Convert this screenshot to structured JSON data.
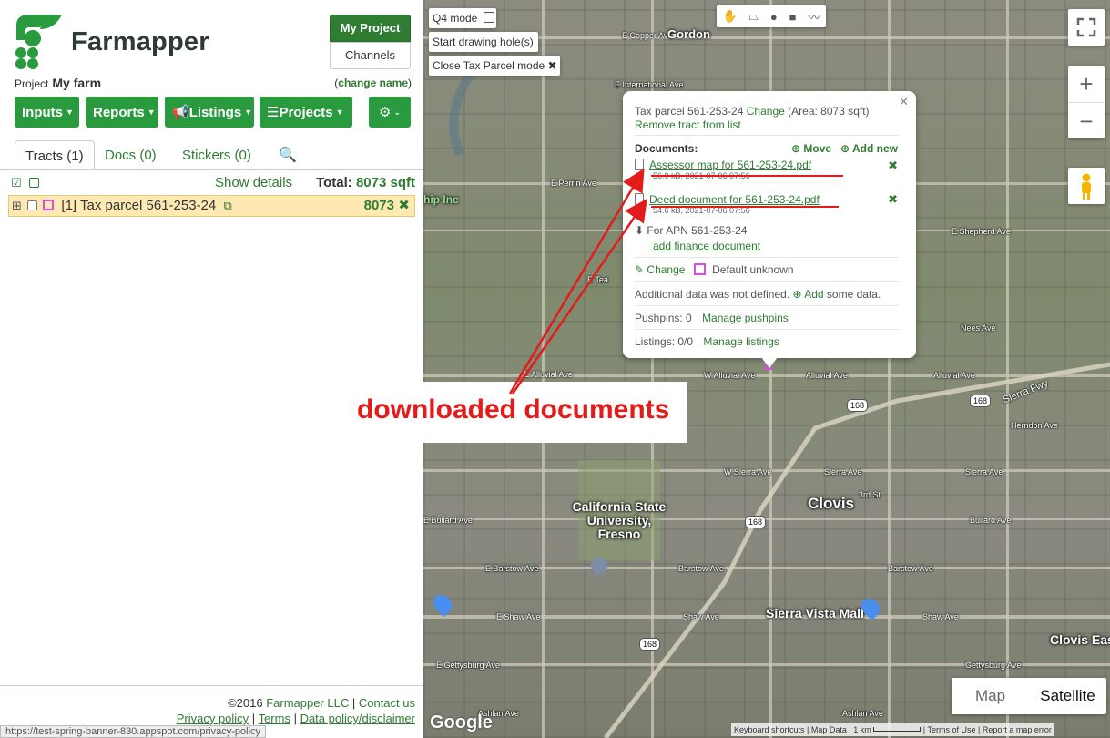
{
  "brand": {
    "name": "Farmapper"
  },
  "header": {
    "my_project_label": "My Project",
    "channels_label": "Channels"
  },
  "project": {
    "prefix": "Project",
    "name": "My farm",
    "change_label": "change name"
  },
  "menu": {
    "inputs": "Inputs",
    "reports": "Reports",
    "listings": "Listings",
    "projects": "Projects"
  },
  "tabs": [
    {
      "label": "Tracts (1)",
      "active": true
    },
    {
      "label": "Docs (0)",
      "active": false
    },
    {
      "label": "Stickers (0)",
      "active": false
    }
  ],
  "tracts": {
    "show_details_label": "Show details",
    "total_label": "Total:",
    "total_value": "8073 sqft",
    "rows": [
      {
        "label": "[1] Tax parcel 561-253-24",
        "area": "8073"
      }
    ]
  },
  "footer": {
    "copyright": "©2016",
    "company": "Farmapper LLC",
    "contact": "Contact us",
    "privacy": "Privacy policy",
    "terms": "Terms",
    "data_policy": "Data policy/disclaimer"
  },
  "status_url": "https://test-spring-banner-830.appspot.com/privacy-policy",
  "map": {
    "q4_mode_label": "Q4 mode",
    "start_drawing_label": "Start drawing hole(s)",
    "close_tax_label": "Close Tax Parcel mode",
    "map_type_map": "Map",
    "map_type_satellite": "Satellite",
    "google_logo": "Google",
    "attribution": {
      "shortcuts": "Keyboard shortcuts",
      "map_data": "Map Data",
      "scale": "1 km",
      "terms": "Terms of Use",
      "report": "Report a map error"
    },
    "places": {
      "gordon": "Gordon",
      "clovis": "Clovis",
      "csu": "California State University, Fresno",
      "sierra_vista": "Sierra Vista Mall",
      "clovis_east": "Clovis Eas",
      "ship_inc": "hip Inc"
    },
    "roads": {
      "copper": "E Copper Ave",
      "international": "E International Ave",
      "perrin": "E Perrin Ave",
      "shepherd": "E Shepherd Ave",
      "nees": "Nees Ave",
      "alluvial_w": "W Alluvial Ave",
      "alluvial": "Alluvial Ave",
      "sierra_fwy": "Sierra Fwy",
      "herndon": "Herndon Ave",
      "sierra_w": "W Sierra Ave",
      "sierra": "Sierra Ave",
      "third": "3rd St",
      "bullard_e": "E Bullard Ave",
      "bullard": "Bullard Ave",
      "barstow_e": "E Barstow Ave",
      "barstow": "Barstow Ave",
      "shaw_e": "E Shaw Ave",
      "shaw": "Shaw Ave",
      "gettysburg_e": "E Gettysburg Ave",
      "gettysburg": "Gettysburg Ave",
      "ashlan": "Ashlan Ave",
      "teague": "E Tea",
      "alluvial_e": "E Alluvial Ave",
      "hwy": "168"
    }
  },
  "popup": {
    "parcel": "Tax parcel 561-253-24",
    "change_label": "Change",
    "area_text": "(Area: 8073 sqft)",
    "remove_label": "Remove tract from list",
    "documents_label": "Documents:",
    "move_label": "Move",
    "add_new_label": "Add new",
    "documents": [
      {
        "name": "Assessor map for 561-253-24.pdf",
        "meta": "56.9 kB, 2021-07-06 07:56"
      },
      {
        "name": "Deed document for 561-253-24.pdf",
        "meta": "54.6 kB, 2021-07-06 07:56"
      }
    ],
    "apn_text": "For APN 561-253-24",
    "add_finance_label": "add finance document",
    "style_change_label": "Change",
    "default_unknown": "Default unknown",
    "additional_data_text": "Additional data was not defined.",
    "add_label": "Add",
    "some_data_text": "some data.",
    "pushpins_text": "Pushpins: 0",
    "manage_pushpins_label": "Manage pushpins",
    "listings_text": "Listings: 0/0",
    "manage_listings_label": "Manage listings"
  },
  "annotation": {
    "text": "downloaded documents"
  },
  "colors": {
    "brand_green": "#2e7d32",
    "button_green": "#2a9a3e",
    "annotation_red": "#e31b1b",
    "tract_highlight": "#fde9b1",
    "parcel_magenta": "#d94fd9"
  }
}
